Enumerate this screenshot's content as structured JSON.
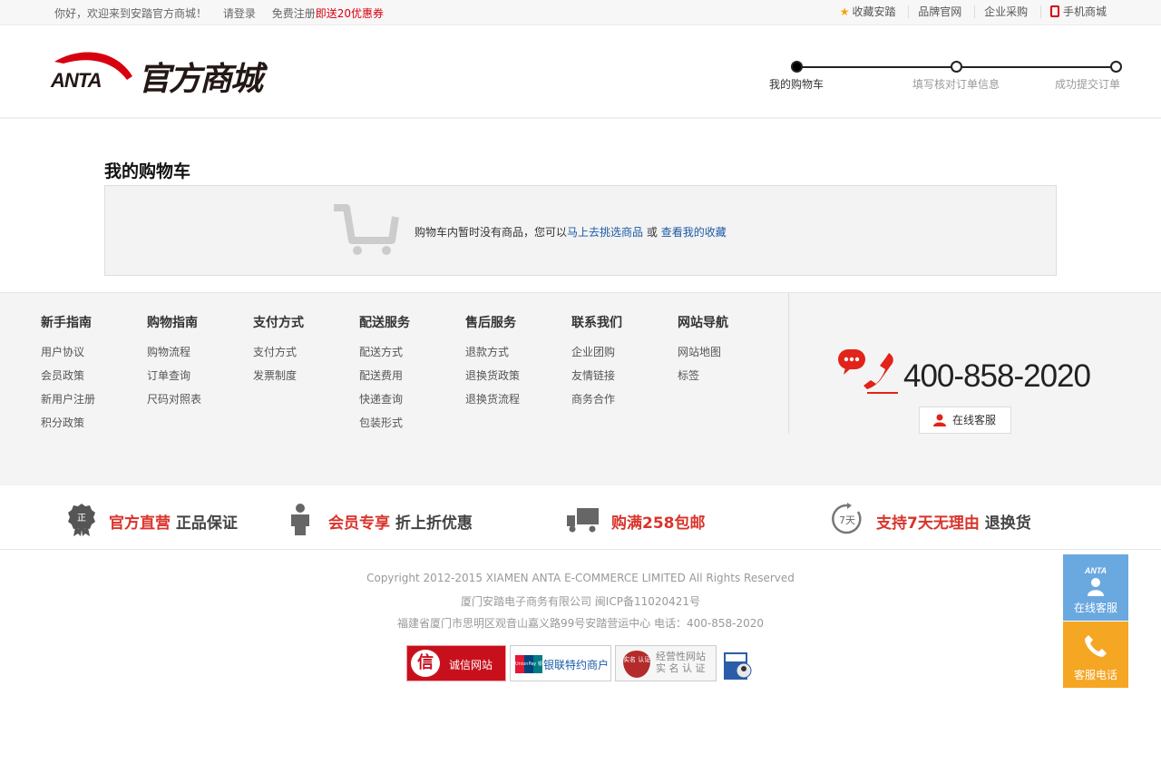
{
  "topbar": {
    "greeting": "你好，欢迎来到安踏官方商城！",
    "login": "请登录",
    "register_prefix": "免费注册",
    "register_promo": "即送20优惠券",
    "favorite": "收藏安踏",
    "brand_site": "品牌官网",
    "enterprise": "企业采购",
    "mobile": "手机商城"
  },
  "logo": {
    "en": "ANTA",
    "cn": "官方商城"
  },
  "steps": [
    "我的购物车",
    "填写核对订单信息",
    "成功提交订单"
  ],
  "cart": {
    "title": "我的购物车",
    "empty_msg": "购物车内暂时没有商品，您可以",
    "link_shop": "马上去挑选商品",
    "or": "或",
    "link_fav": "查看我的收藏"
  },
  "footer_cols": [
    {
      "title": "新手指南",
      "items": [
        "用户协议",
        "会员政策",
        "新用户注册",
        "积分政策"
      ]
    },
    {
      "title": "购物指南",
      "items": [
        "购物流程",
        "订单查询",
        "尺码对照表"
      ]
    },
    {
      "title": "支付方式",
      "items": [
        "支付方式",
        "发票制度"
      ]
    },
    {
      "title": "配送服务",
      "items": [
        "配送方式",
        "配送费用",
        "快递查询",
        "包装形式"
      ]
    },
    {
      "title": "售后服务",
      "items": [
        "退款方式",
        "退换货政策",
        "退换货流程"
      ]
    },
    {
      "title": "联系我们",
      "items": [
        "企业团购",
        "友情链接",
        "商务合作"
      ]
    },
    {
      "title": "网站导航",
      "items": [
        "网站地图",
        "标签"
      ]
    }
  ],
  "hotline": {
    "number": "400-858-2020",
    "service_btn": "在线客服"
  },
  "guarantees": [
    {
      "red": "官方直营",
      "dark": "正品保证",
      "icon": "medal-icon",
      "badge": "正"
    },
    {
      "red": "会员专享",
      "dark": "折上折优惠",
      "icon": "member-icon"
    },
    {
      "red": "购满258包邮",
      "dark": "",
      "icon": "truck-icon"
    },
    {
      "red": "支持7天无理由",
      "dark": "退换货",
      "icon": "seven-day-icon",
      "badge": "7天"
    }
  ],
  "copyright": {
    "line1": "Copyright 2012-2015 XIAMEN ANTA E-COMMERCE LIMITED All Rights Reserved",
    "line2": "厦门安踏电子商务有限公司 闽ICP备11020421号",
    "line3": "福建省厦门市思明区观音山嘉义路99号安踏营运中心 电话：400-858-2020"
  },
  "badges": {
    "credit": "诚信网站",
    "credit_char": "信",
    "unionpay": "银联特约商户",
    "unionpay_logo": "UnionPay 银联",
    "license": "经营性网站\n实 名 认 证",
    "license_seal": "实名 认证"
  },
  "float": {
    "service": "在线客服",
    "phone": "客服电话",
    "logo": "ANTA"
  },
  "colors": {
    "red": "#d7000f",
    "link": "#1a5aa6",
    "float_blue": "#6aa8e0",
    "float_orange": "#f5a623"
  }
}
